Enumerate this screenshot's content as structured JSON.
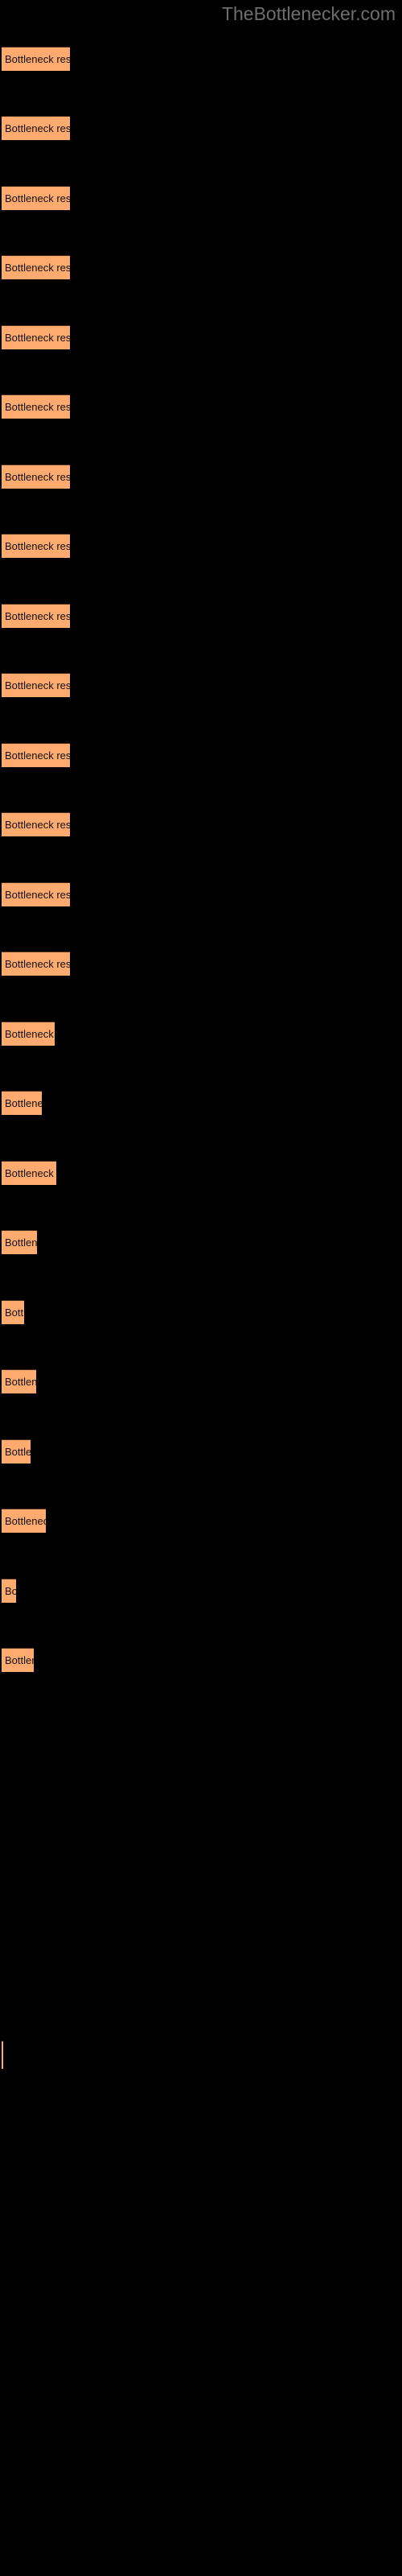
{
  "header": {
    "site_title": "TheBottlenecker.com",
    "color": "#6e6e6e"
  },
  "theme": {
    "background": "#000000",
    "bar_fill": "#ffab70",
    "bar_border": "#4a2d18",
    "label_color": "#111111"
  },
  "chart_data": {
    "type": "bar",
    "orientation": "horizontal",
    "title": "",
    "subtitle": "",
    "xlabel": "",
    "ylabel": "",
    "grid": false,
    "legend": null,
    "axis_labels_visible": false,
    "bar_label_text": "Bottleneck result",
    "categories": [
      "Bottleneck result",
      "Bottleneck result",
      "Bottleneck result",
      "Bottleneck result",
      "Bottleneck result",
      "Bottleneck result",
      "Bottleneck result",
      "Bottleneck result",
      "Bottleneck result",
      "Bottleneck result",
      "Bottleneck result",
      "Bottleneck result",
      "Bottleneck result",
      "Bottleneck result",
      "Bottleneck result",
      "Bottleneck result",
      "Bottleneck result",
      "Bottleneck result",
      "Bottleneck result",
      "Bottleneck result",
      "Bottleneck result",
      "Bottleneck result",
      "Bottleneck result",
      "Bottleneck result"
    ],
    "values": [
      85,
      85,
      85,
      85,
      85,
      85,
      85,
      85,
      85,
      85,
      85,
      85,
      85,
      85,
      66,
      50,
      68,
      44,
      28,
      43,
      36,
      55,
      18,
      40
    ],
    "xlim": [
      0,
      500
    ],
    "bars": [
      {
        "index": 1,
        "label": "Bottleneck result",
        "width": 85,
        "top": 58
      },
      {
        "index": 2,
        "label": "Bottleneck result",
        "width": 85,
        "top": 144
      },
      {
        "index": 3,
        "label": "Bottleneck result",
        "width": 85,
        "top": 231
      },
      {
        "index": 4,
        "label": "Bottleneck result",
        "width": 85,
        "top": 317
      },
      {
        "index": 5,
        "label": "Bottleneck result",
        "width": 85,
        "top": 404
      },
      {
        "index": 6,
        "label": "Bottleneck result",
        "width": 85,
        "top": 490
      },
      {
        "index": 7,
        "label": "Bottleneck result",
        "width": 85,
        "top": 577
      },
      {
        "index": 8,
        "label": "Bottleneck result",
        "width": 85,
        "top": 663
      },
      {
        "index": 9,
        "label": "Bottleneck result",
        "width": 85,
        "top": 750
      },
      {
        "index": 10,
        "label": "Bottleneck result",
        "width": 85,
        "top": 836
      },
      {
        "index": 11,
        "label": "Bottleneck result",
        "width": 85,
        "top": 923
      },
      {
        "index": 12,
        "label": "Bottleneck result",
        "width": 85,
        "top": 1009
      },
      {
        "index": 13,
        "label": "Bottleneck result",
        "width": 85,
        "top": 1096
      },
      {
        "index": 14,
        "label": "Bottleneck result",
        "width": 85,
        "top": 1182
      },
      {
        "index": 15,
        "label": "Bottleneck result",
        "width": 66,
        "top": 1269
      },
      {
        "index": 16,
        "label": "Bottleneck result",
        "width": 50,
        "top": 1355
      },
      {
        "index": 17,
        "label": "Bottleneck result",
        "width": 68,
        "top": 1442
      },
      {
        "index": 18,
        "label": "Bottleneck result",
        "width": 44,
        "top": 1528
      },
      {
        "index": 19,
        "label": "Bottleneck result",
        "width": 28,
        "top": 1615
      },
      {
        "index": 20,
        "label": "Bottleneck result",
        "width": 43,
        "top": 1701
      },
      {
        "index": 21,
        "label": "Bottleneck result",
        "width": 36,
        "top": 1788
      },
      {
        "index": 22,
        "label": "Bottleneck result",
        "width": 55,
        "top": 1874
      },
      {
        "index": 23,
        "label": "Bottleneck result",
        "width": 18,
        "top": 1961
      },
      {
        "index": 24,
        "label": "Bottleneck result",
        "width": 40,
        "top": 2047
      },
      {
        "index": 25,
        "label": "",
        "width": 2,
        "top": 2535,
        "sliver": true,
        "height": 35
      }
    ]
  }
}
